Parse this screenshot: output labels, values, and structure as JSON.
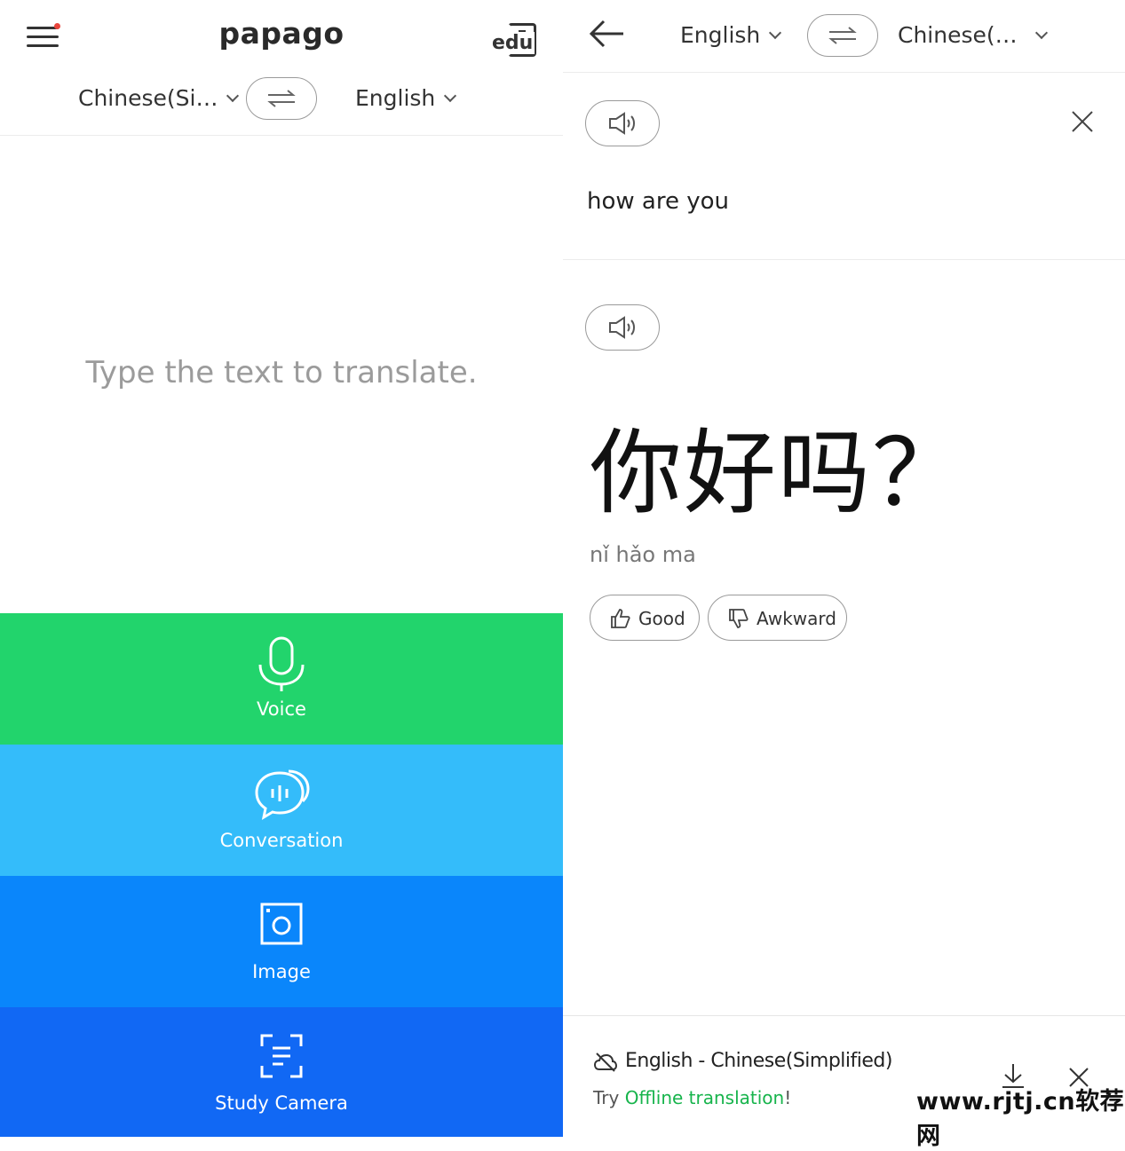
{
  "left": {
    "logo": "papago",
    "edu_label": "edu",
    "source_lang": "Chinese(Si…",
    "target_lang": "English",
    "placeholder": "Type the text to translate.",
    "features": [
      {
        "label": "Voice",
        "icon": "microphone-icon",
        "color": "#22d46c"
      },
      {
        "label": "Conversation",
        "icon": "chat-bubbles-icon",
        "color": "#34bcfa"
      },
      {
        "label": "Image",
        "icon": "camera-icon",
        "color": "#0a86fb"
      },
      {
        "label": "Study Camera",
        "icon": "scan-text-icon",
        "color": "#1168f4"
      }
    ]
  },
  "right": {
    "source_lang": "English",
    "target_lang": "Chinese(…",
    "source_text": "how are you",
    "result_text": "你好吗？",
    "pinyin": "nǐ hǎo ma",
    "feedback": {
      "good": "Good",
      "awkward": "Awkward"
    },
    "offline": {
      "pair": "English - Chinese(Simplified)",
      "try_prefix": "Try ",
      "try_link": "Offline translation",
      "try_suffix": "!"
    },
    "watermark": "www.rjtj.cn软荐网"
  }
}
